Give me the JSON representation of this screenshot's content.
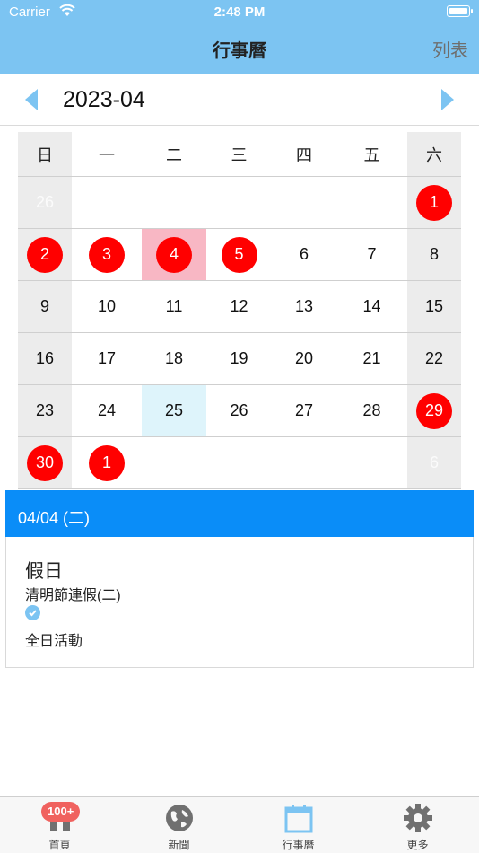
{
  "status_bar": {
    "carrier": "Carrier",
    "time": "2:48 PM"
  },
  "nav": {
    "title": "行事曆",
    "right_button": "列表"
  },
  "month": {
    "label": "2023-04"
  },
  "weekdays": [
    "日",
    "一",
    "二",
    "三",
    "四",
    "五",
    "六"
  ],
  "weeks": [
    [
      "26",
      "",
      "",
      "",
      "",
      "",
      "1"
    ],
    [
      "2",
      "3",
      "4",
      "5",
      "6",
      "7",
      "8"
    ],
    [
      "9",
      "10",
      "11",
      "12",
      "13",
      "14",
      "15"
    ],
    [
      "16",
      "17",
      "18",
      "19",
      "20",
      "21",
      "22"
    ],
    [
      "23",
      "24",
      "25",
      "26",
      "27",
      "28",
      "29"
    ],
    [
      "30",
      "1",
      "",
      "",
      "",
      "",
      "6"
    ]
  ],
  "event": {
    "date_header": "04/04 (二)",
    "title": "假日",
    "name": "清明節連假(二)",
    "allday": "全日活動"
  },
  "tabs": [
    {
      "label": "首頁",
      "badge": "100+",
      "icon": "home-icon"
    },
    {
      "label": "新聞",
      "icon": "globe-icon"
    },
    {
      "label": "行事曆",
      "icon": "calendar-icon"
    },
    {
      "label": "更多",
      "icon": "gear-icon"
    }
  ],
  "colors": {
    "nav_bg": "#7cc4f2",
    "holiday_circle": "#ff0000",
    "selected_day": "#f8b7c4",
    "today": "#def4fb",
    "event_bar": "#0a8df8"
  }
}
